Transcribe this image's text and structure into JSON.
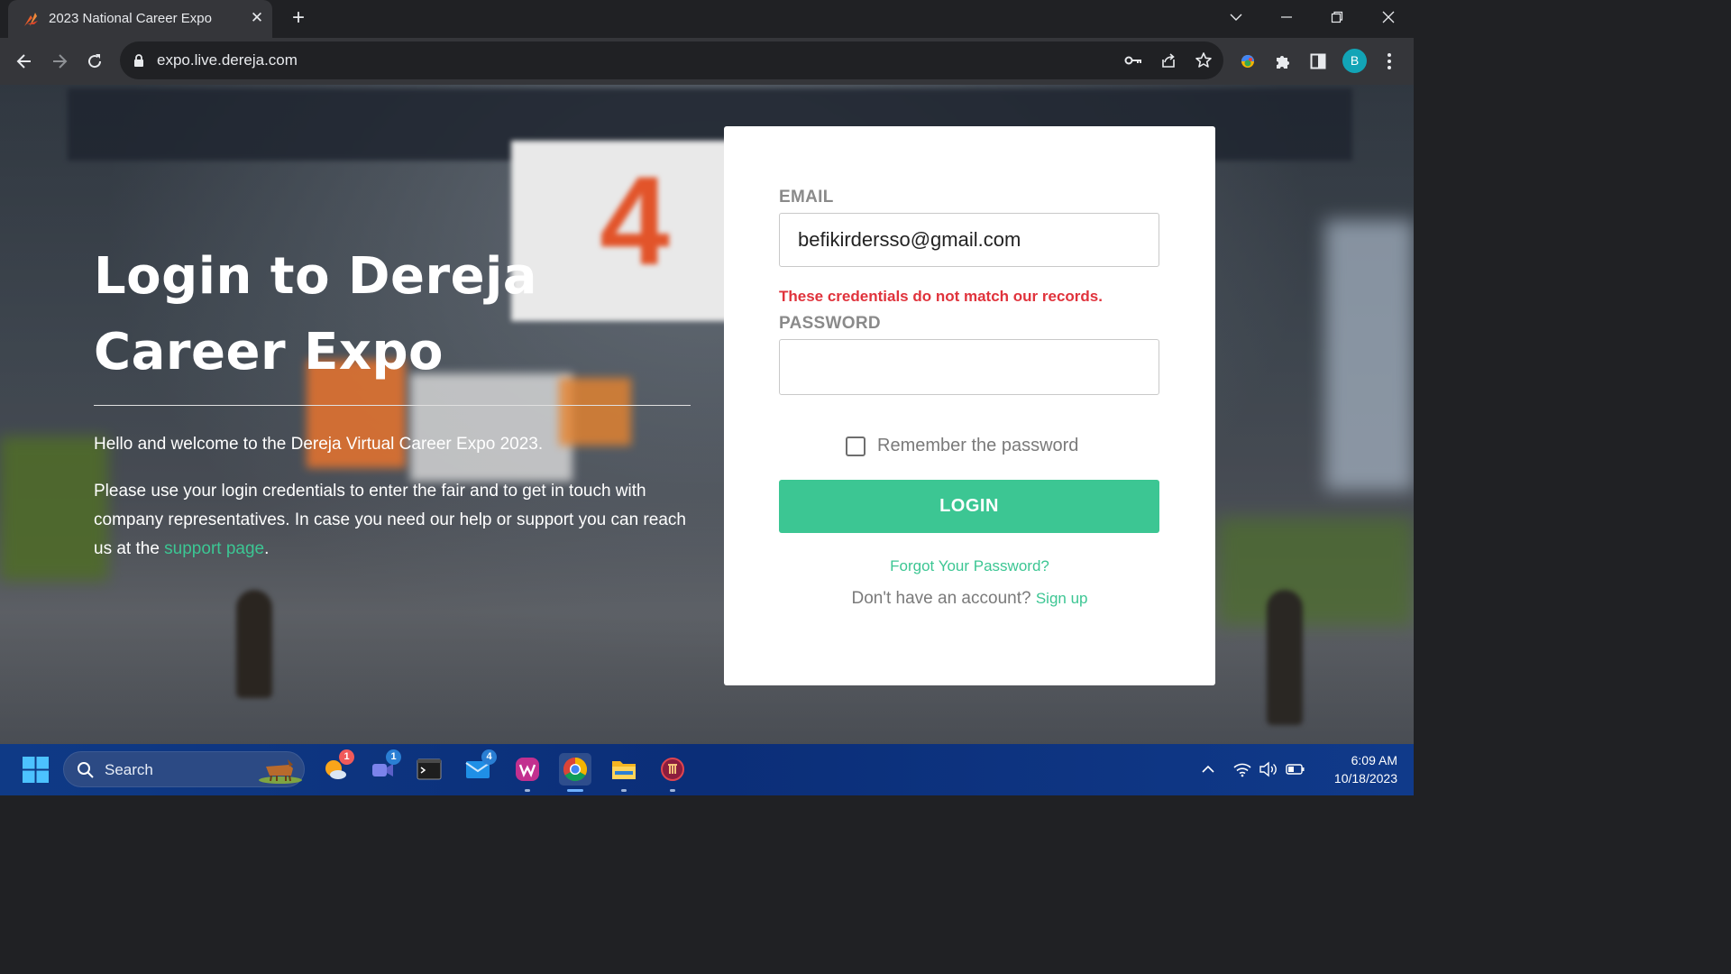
{
  "browser": {
    "tab_title": "2023 National Career Expo",
    "url": "expo.live.dereja.com",
    "profile_initial": "B"
  },
  "page": {
    "title_line1": "Login to Dereja",
    "title_line2": "Career Expo",
    "welcome": "Hello and welcome to the Dereja Virtual Career Expo 2023.",
    "intro_text": "Please use your login credentials to enter the fair and to get in touch with company representatives. In case you need our help or support you can reach us at the ",
    "support_link": "support page",
    "intro_end": "."
  },
  "login": {
    "email_label": "EMAIL",
    "email_value": "befikirdersso@gmail.com",
    "error": "These credentials do not match our records.",
    "password_label": "PASSWORD",
    "password_value": "",
    "remember_label": "Remember the password",
    "remember_checked": false,
    "login_button": "LOGIN",
    "forgot_link": "Forgot Your Password?",
    "no_account_text": "Don't have an account?",
    "signup_link": "Sign up"
  },
  "taskbar": {
    "search_placeholder": "Search",
    "badges": {
      "weather": "1",
      "teams": "1",
      "mail": "4"
    },
    "time": "6:09 AM",
    "date": "10/18/2023"
  },
  "colors": {
    "accent_green": "#3cc693",
    "error_red": "#e0333c",
    "profile_teal": "#12a4b6"
  }
}
